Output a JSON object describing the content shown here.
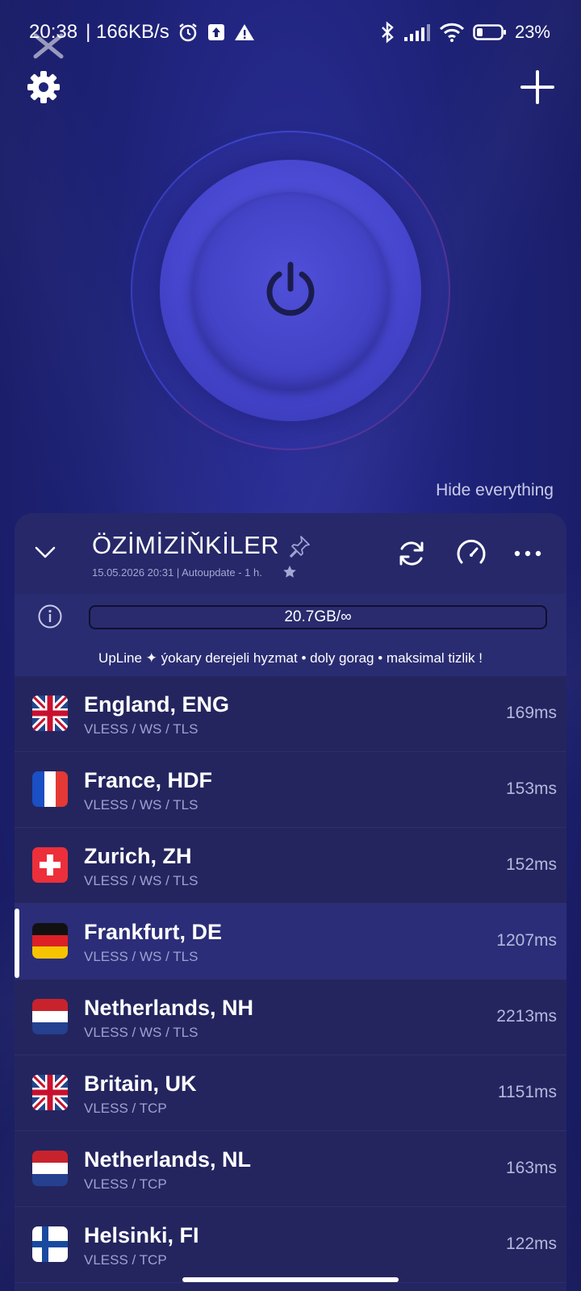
{
  "status_bar": {
    "time": "20:38",
    "net_speed": "| 166KB/s",
    "battery": "23%",
    "icons": [
      "alarm-icon",
      "upload-icon",
      "warning-icon",
      "bluetooth-icon",
      "signal-icon",
      "wifi-icon",
      "battery-icon"
    ]
  },
  "top": {
    "settings_icon": "gear-icon",
    "add_icon": "plus-icon"
  },
  "power": {
    "icon": "power-icon"
  },
  "hide_everything": "Hide everything",
  "group": {
    "title": "ÖZİMİZİŇKİLER",
    "subtitle": "15.05.2026 20:31 | Autoupdate - 1 h.",
    "usage": "20.7GB/∞",
    "promo": "UpLine ✦ ýokary derejeli hyzmat • doly gorag • maksimal tizlik !"
  },
  "servers": [
    {
      "name": "England, ENG",
      "protocol": "VLESS / WS / TLS",
      "ping": "169ms",
      "flag": "uk"
    },
    {
      "name": "France, HDF",
      "protocol": "VLESS / WS / TLS",
      "ping": "153ms",
      "flag": "fr"
    },
    {
      "name": "Zurich, ZH",
      "protocol": "VLESS / WS / TLS",
      "ping": "152ms",
      "flag": "ch"
    },
    {
      "name": "Frankfurt, DE",
      "protocol": "VLESS / WS / TLS",
      "ping": "1207ms",
      "flag": "de",
      "active": true
    },
    {
      "name": "Netherlands, NH",
      "protocol": "VLESS / WS / TLS",
      "ping": "2213ms",
      "flag": "nl"
    },
    {
      "name": "Britain, UK",
      "protocol": "VLESS / TCP",
      "ping": "1151ms",
      "flag": "uk"
    },
    {
      "name": "Netherlands, NL",
      "protocol": "VLESS / TCP",
      "ping": "163ms",
      "flag": "nl"
    },
    {
      "name": "Helsinki, FI",
      "protocol": "VLESS / TCP",
      "ping": "122ms",
      "flag": "fi"
    }
  ],
  "colors": {
    "background": "#1e2277",
    "accent": "#4646cf",
    "panel": "#242563"
  }
}
